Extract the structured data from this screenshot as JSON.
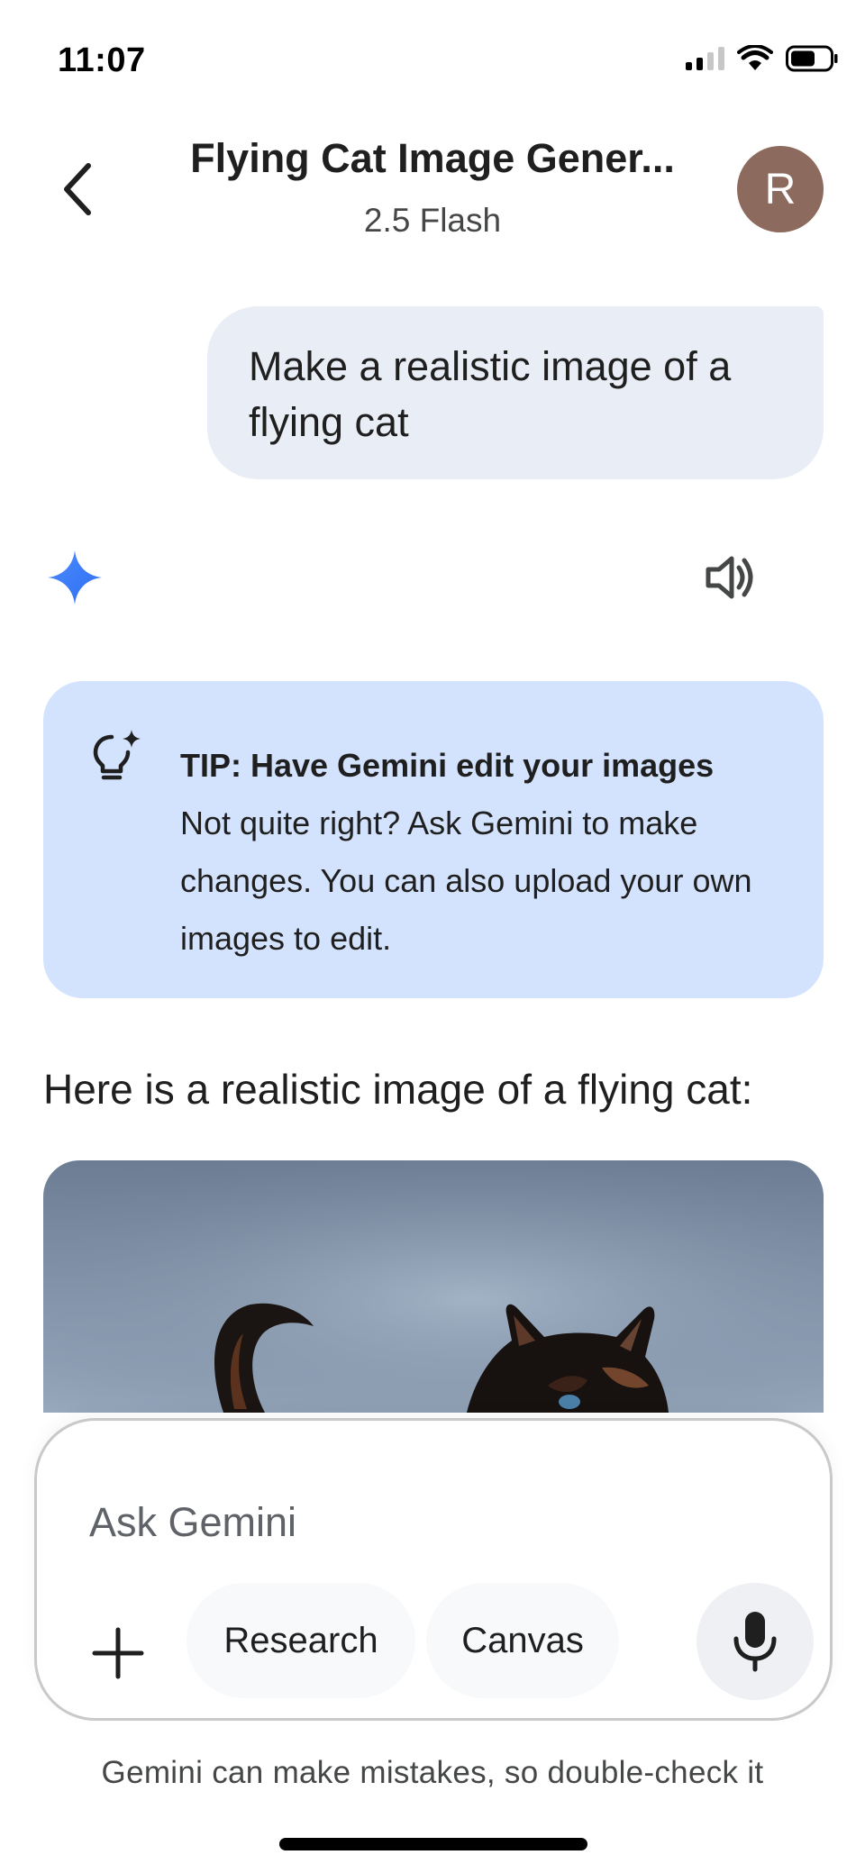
{
  "status_bar": {
    "time": "11:07"
  },
  "header": {
    "title": "Flying Cat Image Gener...",
    "model": "2.5 Flash",
    "avatar_initial": "R",
    "avatar_color": "#8d6a5e"
  },
  "conversation": {
    "user_message": "Make a realistic image of a flying cat",
    "tip": {
      "title": "TIP: Have Gemini edit your images",
      "body": "Not quite right? Ask Gemini to make changes. You can also upload your own images to edit."
    },
    "response_text": "Here is a realistic image of a flying cat:",
    "gem_color": "#4285f4"
  },
  "composer": {
    "placeholder": "Ask Gemini",
    "chips": [
      "Research",
      "Canvas"
    ],
    "icons": [
      "plus-icon",
      "microphone-icon"
    ]
  },
  "footer": {
    "disclaimer": "Gemini can make mistakes, so double-check it"
  }
}
